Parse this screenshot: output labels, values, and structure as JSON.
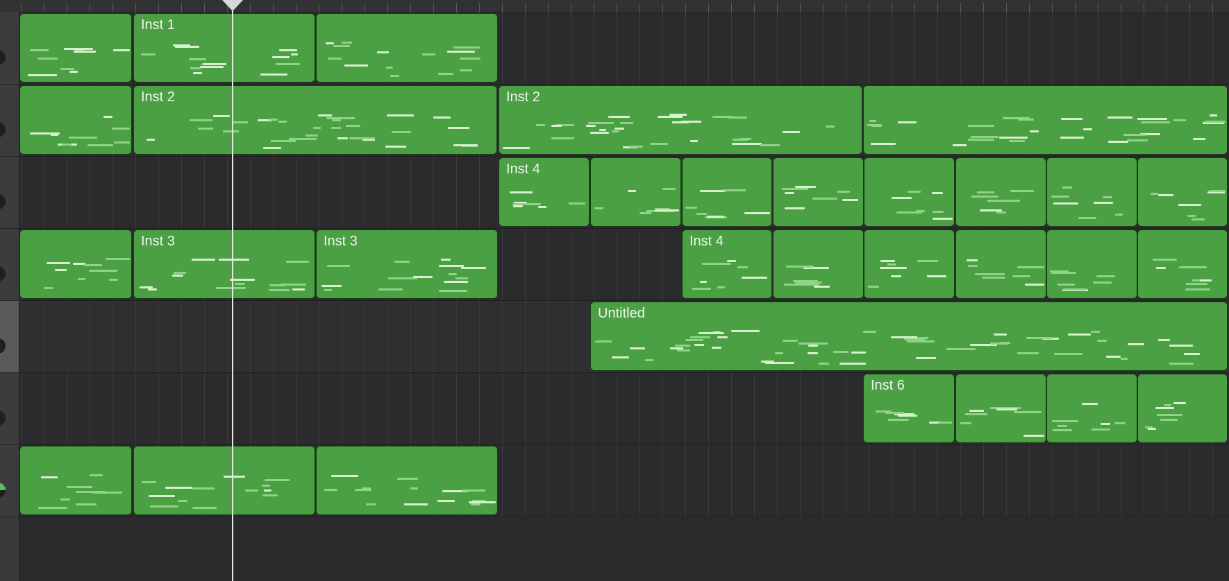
{
  "colors": {
    "region_fill": "#4aa043",
    "region_border": "#173d15",
    "note": "#d7f0cf",
    "background": "#2b2b2d",
    "playhead": "#e6e6e6"
  },
  "tracks": [
    {
      "regions": [
        {
          "label": ""
        },
        {
          "label": "Inst 1"
        },
        {
          "label": ""
        }
      ]
    },
    {
      "regions": [
        {
          "label": ""
        },
        {
          "label": "Inst 2"
        },
        {
          "label": "Inst 2"
        },
        {
          "label": ""
        }
      ]
    },
    {
      "regions": [
        {
          "label": "Inst 4"
        },
        {
          "label": ""
        },
        {
          "label": ""
        },
        {
          "label": ""
        },
        {
          "label": ""
        },
        {
          "label": ""
        },
        {
          "label": ""
        },
        {
          "label": ""
        }
      ]
    },
    {
      "regions": [
        {
          "label": ""
        },
        {
          "label": "Inst 3"
        },
        {
          "label": "Inst 3"
        },
        {
          "label": "Inst 4"
        },
        {
          "label": ""
        },
        {
          "label": ""
        },
        {
          "label": ""
        },
        {
          "label": ""
        },
        {
          "label": ""
        }
      ]
    },
    {
      "regions": [
        {
          "label": "Untitled"
        }
      ]
    },
    {
      "regions": [
        {
          "label": "Inst 6"
        },
        {
          "label": ""
        },
        {
          "label": ""
        },
        {
          "label": ""
        }
      ]
    },
    {
      "regions": [
        {
          "label": ""
        },
        {
          "label": ""
        },
        {
          "label": ""
        }
      ]
    }
  ]
}
